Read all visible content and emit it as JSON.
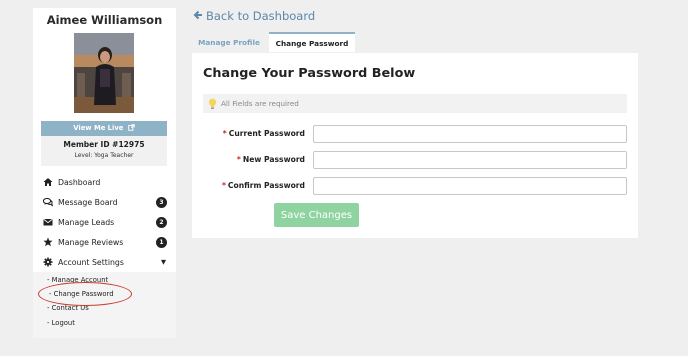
{
  "sidebar": {
    "user_name": "Aimee Williamson",
    "avatar_icon": "profile-photo",
    "view_live_label": "View Me Live",
    "member_id": "Member ID #12975",
    "member_level": "Level: Yoga Teacher",
    "nav": [
      {
        "label": "Dashboard",
        "icon": "home-icon",
        "badge": ""
      },
      {
        "label": "Message Board",
        "icon": "comments-icon",
        "badge": "3"
      },
      {
        "label": "Manage Leads",
        "icon": "envelope-icon",
        "badge": "2"
      },
      {
        "label": "Manage Reviews",
        "icon": "star-icon",
        "badge": "1"
      },
      {
        "label": "Account Settings",
        "icon": "gear-icon",
        "badge": ""
      }
    ],
    "submenu": [
      "- Manage Account",
      "- Change Password",
      "- Contact Us",
      "- Logout"
    ]
  },
  "main": {
    "back_label": "Back to Dashboard",
    "tabs": [
      {
        "label": "Manage Profile",
        "active": false
      },
      {
        "label": "Change Password",
        "active": true
      }
    ],
    "title": "Change Your Password Below",
    "notice": "All Fields are required",
    "fields": [
      {
        "label": "Current Password",
        "value": "",
        "placeholder": ""
      },
      {
        "label": "New Password",
        "value": "",
        "placeholder": ""
      },
      {
        "label": "Confirm Password",
        "value": "",
        "placeholder": ""
      }
    ],
    "required_marker": "*",
    "save_label": "Save Changes"
  },
  "colors": {
    "accent": "#8eb2c6",
    "link": "#5b87a8",
    "save_button": "#8fd3a0",
    "highlight": "#c83a2f",
    "required": "#c62828"
  }
}
